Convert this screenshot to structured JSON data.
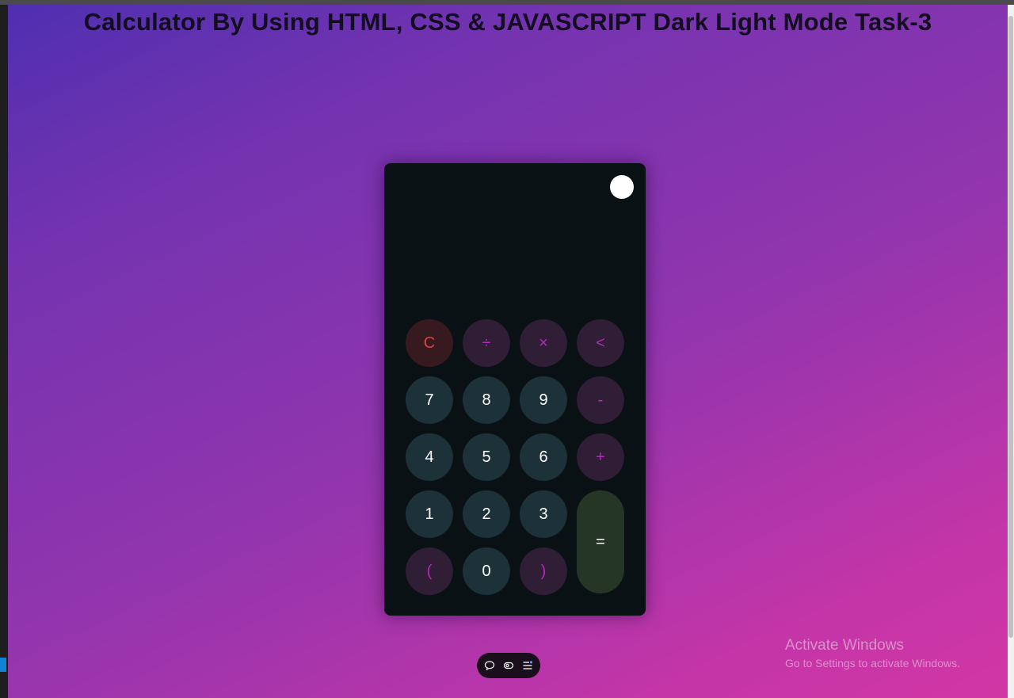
{
  "page": {
    "title": "Calculator By Using HTML, CSS & JAVASCRIPT Dark Light Mode Task-3"
  },
  "calculator": {
    "display_value": "",
    "theme_toggle_icon": "circle-toggle-icon",
    "keys": {
      "clear": "C",
      "divide": "÷",
      "multiply": "×",
      "backspace": "<",
      "seven": "7",
      "eight": "8",
      "nine": "9",
      "minus": "-",
      "four": "4",
      "five": "5",
      "six": "6",
      "plus": "+",
      "one": "1",
      "two": "2",
      "three": "3",
      "equals": "=",
      "open_paren": "(",
      "zero": "0",
      "close_paren": ")"
    },
    "colors": {
      "body": "#091114",
      "number_key": "#1c3138",
      "operator_key": "#301d36",
      "operator_text": "#b32ab8",
      "clear_key": "#371a1f",
      "clear_text": "#d94141",
      "equals_key": "#253526"
    }
  },
  "dock": {
    "icons": [
      "chat-bubble-icon",
      "eye-toggle-icon",
      "menu-list-icon"
    ]
  },
  "watermark": {
    "title": "Activate Windows",
    "subtitle": "Go to Settings to activate Windows."
  },
  "colors": {
    "background_gradient_start": "#4f2fb0",
    "background_gradient_end": "#d236a5",
    "title_text": "#130d20"
  }
}
